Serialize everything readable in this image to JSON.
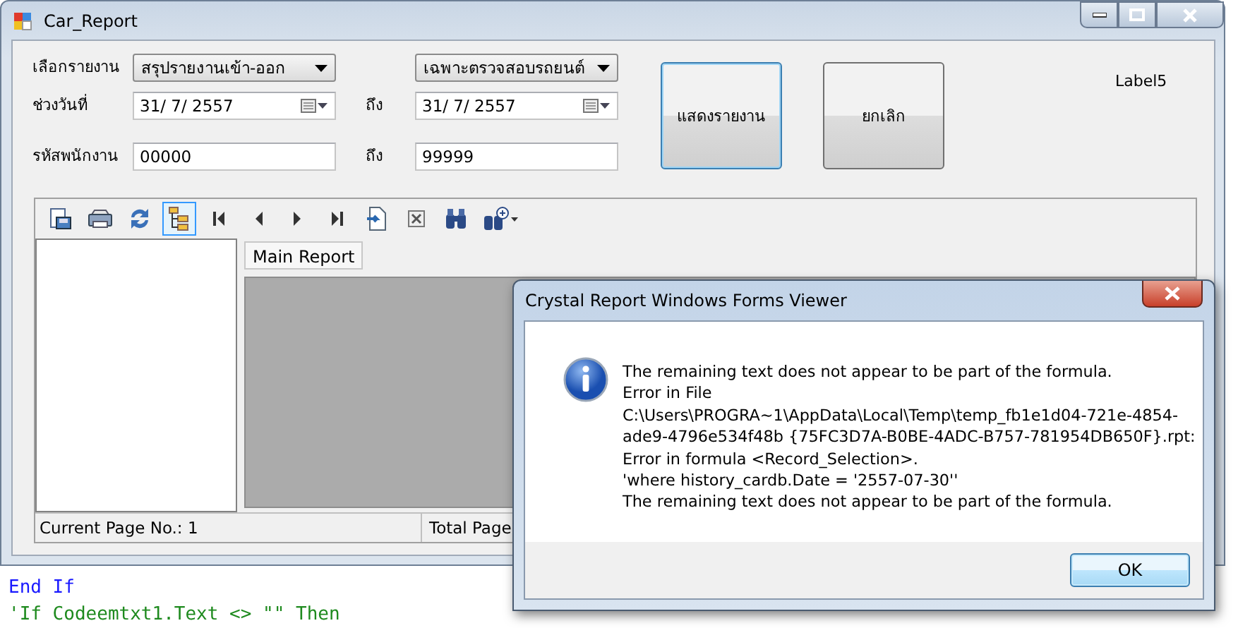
{
  "main_window": {
    "title": "Car_Report",
    "form": {
      "report_label": "เลือกรายงาน",
      "report_type": "สรุปรายงานเข้า-ออก",
      "report_filter": "เฉพาะตรวจสอบรถยนต์",
      "date_label": "ช่วงวันที่",
      "date_from": "31/ 7/ 2557",
      "date_to_label": "ถึง",
      "date_to": "31/ 7/ 2557",
      "employee_label": "รหัสพนักงาน",
      "employee_from": "00000",
      "employee_to_label": "ถึง",
      "employee_to": "99999",
      "show_button": "แสดงรายงาน",
      "cancel_button": "ยกเลิก",
      "label5": "Label5"
    },
    "viewer": {
      "toolbar": [
        {
          "kind": "export",
          "selected": false
        },
        {
          "kind": "print",
          "selected": false
        },
        {
          "kind": "refresh",
          "selected": false
        },
        {
          "kind": "group-tree",
          "selected": true
        },
        {
          "kind": "first",
          "selected": false
        },
        {
          "kind": "prev",
          "selected": false
        },
        {
          "kind": "next",
          "selected": false
        },
        {
          "kind": "last",
          "selected": false
        },
        {
          "kind": "goto",
          "selected": false
        },
        {
          "kind": "stop",
          "selected": false
        },
        {
          "kind": "find",
          "selected": false
        },
        {
          "kind": "zoom",
          "selected": false
        }
      ],
      "tab": "Main Report",
      "current_page": "Current Page No.: 1",
      "total_page": "Total Page"
    }
  },
  "dialog": {
    "title": "Crystal Report Windows Forms Viewer",
    "message": [
      "The remaining text does not appear to be part of the formula.",
      "Error in File",
      "C:\\Users\\PROGRA~1\\AppData\\Local\\Temp\\temp_fb1e1d04-721e-4854-",
      "ade9-4796e534f48b {75FC3D7A-B0BE-4ADC-B757-781954DB650F}.rpt:",
      "Error in formula  <Record_Selection>.",
      "'where history_cardb.Date = '2557-07-30''",
      "The remaining text does not appear to be part of the formula."
    ],
    "ok_button": "OK"
  },
  "code_lines": [
    {
      "kind": "keyword",
      "text": "End If"
    },
    {
      "kind": "comment",
      "text": "'If Codeemtxt1.Text <> \"\" Then"
    }
  ]
}
